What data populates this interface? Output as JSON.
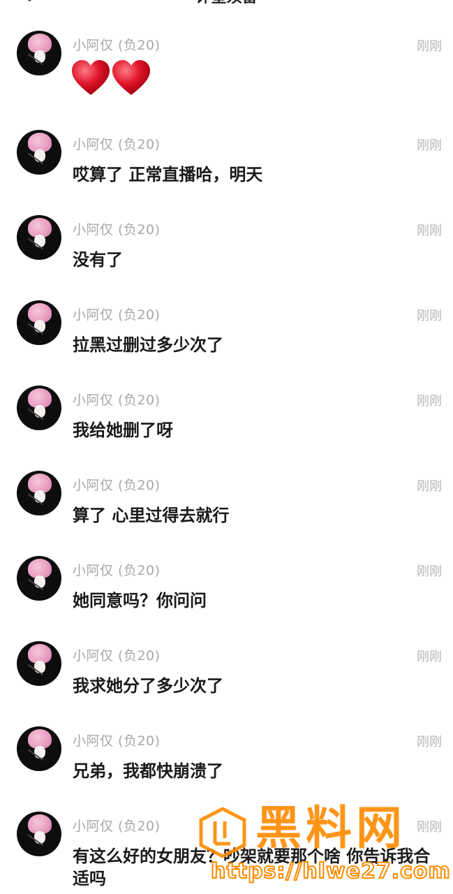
{
  "header": {
    "back_glyph": "<",
    "title": "评星须留"
  },
  "messages": [
    {
      "name": "小阿仅 (负20)",
      "time": "刚刚",
      "text": "",
      "hearts": 2
    },
    {
      "name": "小阿仅 (负20)",
      "time": "刚刚",
      "text": "哎算了 正常直播哈，明天"
    },
    {
      "name": "小阿仅 (负20)",
      "time": "刚刚",
      "text": "没有了"
    },
    {
      "name": "小阿仅 (负20)",
      "time": "刚刚",
      "text": "拉黑过删过多少次了"
    },
    {
      "name": "小阿仅 (负20)",
      "time": "刚刚",
      "text": "我给她删了呀"
    },
    {
      "name": "小阿仅 (负20)",
      "time": "刚刚",
      "text": "算了 心里过得去就行"
    },
    {
      "name": "小阿仅 (负20)",
      "time": "刚刚",
      "text": "她同意吗？你问问"
    },
    {
      "name": "小阿仅 (负20)",
      "time": "刚刚",
      "text": "我求她分了多少次了"
    },
    {
      "name": "小阿仅 (负20)",
      "time": "刚刚",
      "text": "兄弟，我都快崩溃了"
    },
    {
      "name": "小阿仅 (负20)",
      "time": "刚刚",
      "text": "有这么好的女朋友？吵架就要那个啥 你告诉我合适吗"
    }
  ],
  "watermark": {
    "brand": "黑料网",
    "url": "https://hlwe27.com",
    "color": "#ff8a00"
  },
  "colors": {
    "heart": "#e0142a",
    "name": "#a8a8a8",
    "text": "#1a1a1a"
  }
}
